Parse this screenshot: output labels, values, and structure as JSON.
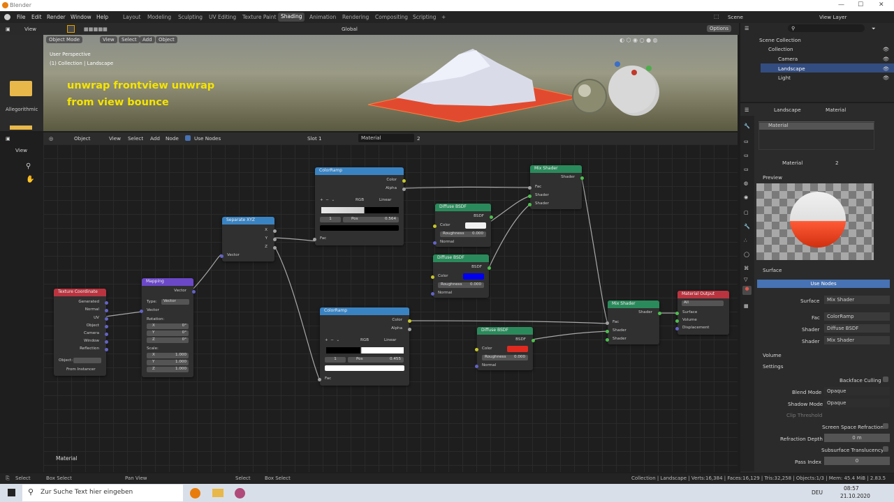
{
  "window": {
    "title": "Blender"
  },
  "menubar": {
    "items": [
      "File",
      "Edit",
      "Render",
      "Window",
      "Help"
    ],
    "workspaces": [
      "Layout",
      "Modeling",
      "Sculpting",
      "UV Editing",
      "Texture Paint",
      "Shading",
      "Animation",
      "Rendering",
      "Compositing",
      "Scripting"
    ],
    "active_workspace": "Shading",
    "add_tab": "+",
    "scene": "Scene",
    "view_layer": "View Layer"
  },
  "viewport_top": {
    "view": "View",
    "orientation": "Global",
    "options": "Options"
  },
  "viewport": {
    "mode": "Object Mode",
    "menus": [
      "View",
      "Select",
      "Add",
      "Object"
    ],
    "perspective": "User Perspective",
    "collection_info": "(1) Collection | Landscape",
    "overlay_text_1": "unwrap frontview unwrap",
    "overlay_text_2": "from view bounce",
    "asset_label": "Allegorithmic"
  },
  "node_header": {
    "editor": "Object",
    "menus": [
      "View",
      "Select",
      "Add",
      "Node"
    ],
    "use_nodes": "Use Nodes",
    "slot": "Slot 1",
    "material": "Material",
    "users": "2"
  },
  "left_toolbar": {
    "view": "View"
  },
  "nodes": {
    "texcoord": {
      "title": "Texture Coordinate",
      "outputs": [
        "Generated",
        "Normal",
        "UV",
        "Object",
        "Camera",
        "Window",
        "Reflection"
      ],
      "object_label": "Object:",
      "from_instancer": "From Instancer"
    },
    "mapping": {
      "title": "Mapping",
      "out": "Vector",
      "type_label": "Type:",
      "type": "Vector",
      "in_vector": "Vector",
      "location_label": "Location:",
      "rotation_label": "Rotation:",
      "rx": "0°",
      "ry": "0°",
      "rz": "0°",
      "scale_label": "Scale:",
      "sx": "1.000",
      "sy": "1.000",
      "sz": "1.000"
    },
    "separate": {
      "title": "Separate XYZ",
      "outputs": [
        "X",
        "Y",
        "Z"
      ],
      "in": "Vector"
    },
    "ramp1": {
      "title": "ColorRamp",
      "out_color": "Color",
      "out_alpha": "Alpha",
      "mode": "RGB",
      "interp": "Linear",
      "index": "1",
      "pos_label": "Pos",
      "pos": "0.564",
      "in": "Fac"
    },
    "ramp2": {
      "title": "ColorRamp",
      "out_color": "Color",
      "out_alpha": "Alpha",
      "mode": "RGB",
      "interp": "Linear",
      "index": "1",
      "pos_label": "Pos",
      "pos": "0.455",
      "in": "Fac"
    },
    "diffuse1": {
      "title": "Diffuse BSDF",
      "out": "BSDF",
      "color": "Color",
      "rough": "Roughness",
      "rough_val": "0.000",
      "normal": "Normal",
      "swatch": "#f2f2f2"
    },
    "diffuse2": {
      "title": "Diffuse BSDF",
      "out": "BSDF",
      "color": "Color",
      "rough": "Roughness",
      "rough_val": "0.000",
      "normal": "Normal",
      "swatch": "#0000ee"
    },
    "diffuse3": {
      "title": "Diffuse BSDF",
      "out": "BSDF",
      "color": "Color",
      "rough": "Roughness",
      "rough_val": "0.000",
      "normal": "Normal",
      "swatch": "#e02a20"
    },
    "mix1": {
      "title": "Mix Shader",
      "out": "Shader",
      "fac": "Fac",
      "s1": "Shader",
      "s2": "Shader"
    },
    "mix2": {
      "title": "Mix Shader",
      "out": "Shader",
      "fac": "Fac",
      "s1": "Shader",
      "s2": "Shader"
    },
    "output": {
      "title": "Material Output",
      "target": "All",
      "surface": "Surface",
      "volume": "Volume",
      "displacement": "Displacement"
    }
  },
  "node_footer": "Material",
  "outliner": {
    "root": "Scene Collection",
    "collection": "Collection",
    "items": [
      "Camera",
      "Landscape",
      "Light"
    ]
  },
  "properties": {
    "object": "Landscape",
    "material_tab": "Material",
    "slot_name": "Material",
    "datablock": "Material",
    "users": "2",
    "preview": "Preview",
    "surface_section": "Surface",
    "use_nodes": "Use Nodes",
    "rows": [
      {
        "label": "Surface",
        "value": "Mix Shader"
      },
      {
        "label": "Fac",
        "value": "ColorRamp"
      },
      {
        "label": "Shader",
        "value": "Diffuse BSDF"
      },
      {
        "label": "Shader",
        "value": "Mix Shader"
      }
    ],
    "volume": "Volume",
    "settings": "Settings",
    "backface": "Backface Culling",
    "blend_label": "Blend Mode",
    "blend": "Opaque",
    "shadow_label": "Shadow Mode",
    "shadow": "Opaque",
    "clip": "Clip Threshold",
    "ssr": "Screen Space Refraction",
    "refr_label": "Refraction Depth",
    "refr": "0 m",
    "sst": "Subsurface Translucency",
    "pass_label": "Pass Index",
    "pass": "0"
  },
  "statusbar": {
    "select": "Select",
    "box_select": "Box Select",
    "pan_view": "Pan View",
    "select2": "Select",
    "box_select2": "Box Select",
    "stats": "Collection | Landscape | Verts:16,384 | Faces:16,129 | Tris:32,258 | Objects:1/3 | Mem: 45.4 MiB | 2.83.5"
  },
  "taskbar": {
    "search_placeholder": "Zur Suche Text hier eingeben",
    "lang": "DEU",
    "time": "08:57",
    "date": "21.10.2020"
  },
  "colors": {
    "accent": "#4772b3",
    "shader_header": "#2b8a5b",
    "converter_header": "#3a83c2",
    "input_header": "#b9343f",
    "vector_header": "#6b48c8"
  }
}
